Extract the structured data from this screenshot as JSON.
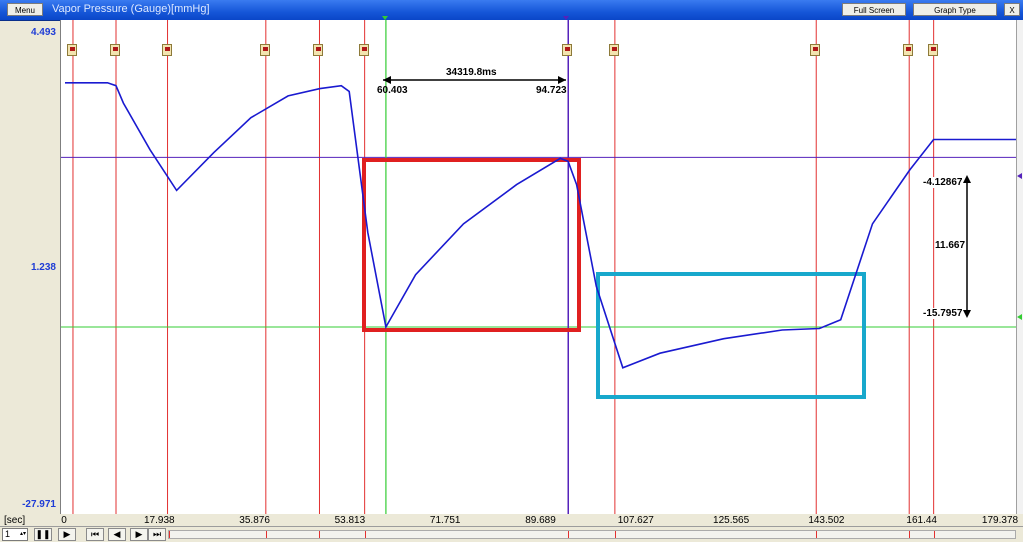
{
  "window": {
    "title": "Vapor Pressure (Gauge)[mmHg]",
    "menu_label": "Menu",
    "fullscreen_label": "Full Screen",
    "graphtype_label": "Graph Type",
    "close_label": "X"
  },
  "axes": {
    "y_ticks": [
      "4.493",
      "1.238",
      "-27.971"
    ],
    "x_unit": "[sec]",
    "x_ticks": [
      "0",
      "17.938",
      "35.876",
      "53.813",
      "71.751",
      "89.689",
      "107.627",
      "125.565",
      "143.502",
      "161.44",
      "179.378"
    ]
  },
  "cursors": {
    "delta_time": "34319.8ms",
    "left_time": "60.403",
    "right_time": "94.723",
    "upper_value": "-4.12867",
    "lower_value": "-15.7957",
    "delta_value": "11.667"
  },
  "playback": {
    "speed_value": "1",
    "controls": [
      "pause",
      "play",
      "first",
      "prev",
      "next",
      "last"
    ]
  },
  "colors": {
    "trace": "#1a1ad0",
    "event_line": "#e23030",
    "left_cursor": "#33cc33",
    "right_cursor": "#5522bb",
    "highlight_1": "#e02020",
    "highlight_2": "#18a8cc"
  },
  "chart_data": {
    "type": "line",
    "title": "Vapor Pressure (Gauge)[mmHg]",
    "xlabel": "[sec]",
    "ylabel": "",
    "xlim": [
      0,
      179.378
    ],
    "ylim": [
      -27.971,
      4.493
    ],
    "series": [
      {
        "name": "Vapor Pressure (Gauge)[mmHg]",
        "x": [
          0,
          8,
          9.6,
          11,
          16,
          21,
          28,
          35,
          42,
          48,
          52,
          53.5,
          57,
          60.4,
          66,
          75,
          85,
          93.2,
          94.7,
          96.3,
          100,
          105,
          112,
          124,
          135,
          142,
          146,
          152,
          159,
          163.5,
          170,
          179.5
        ],
        "y": [
          1.0,
          1.0,
          0.8,
          -0.4,
          -3.6,
          -6.4,
          -3.8,
          -1.4,
          0.1,
          0.6,
          0.8,
          0.4,
          -9.3,
          -15.8,
          -12.2,
          -8.7,
          -6.0,
          -4.2,
          -4.4,
          -6.0,
          -13.0,
          -18.6,
          -17.6,
          -16.6,
          -16.0,
          -15.9,
          -15.3,
          -8.7,
          -5.0,
          -2.9,
          -2.9,
          -2.9
        ]
      }
    ],
    "event_markers_x": [
      1.5,
      9.6,
      19.3,
      37.8,
      47.9,
      56.4,
      94.7,
      103.5,
      141.4,
      158.9,
      163.5
    ],
    "cursor_x": [
      60.403,
      94.723
    ],
    "cursor_y": [
      -4.12867,
      -15.7957
    ]
  }
}
